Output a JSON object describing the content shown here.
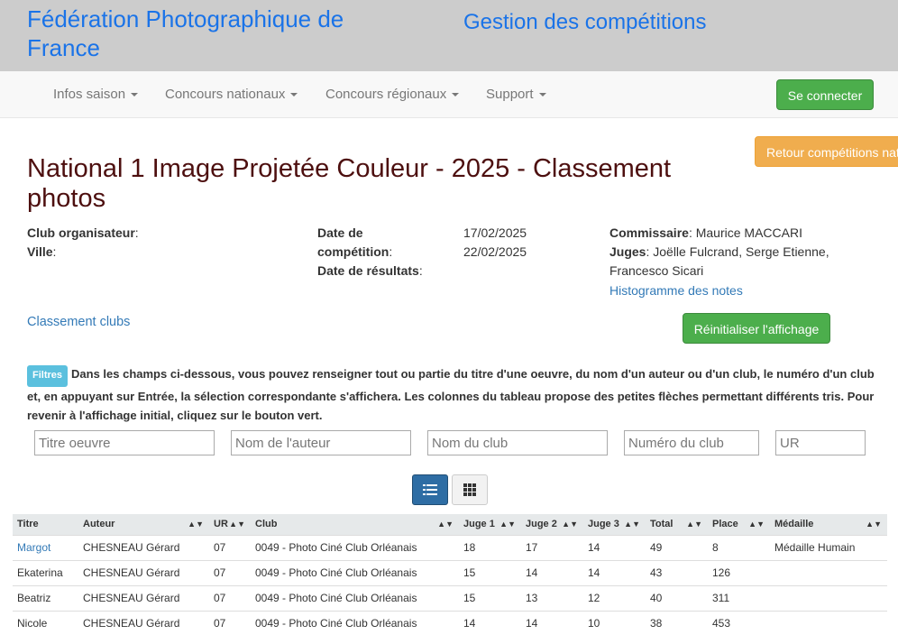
{
  "header": {
    "org_title": "Fédération Photographique de France",
    "app_title": "Gestion des compétitions"
  },
  "nav": {
    "items": [
      "Infos saison",
      "Concours nationaux",
      "Concours régionaux",
      "Support"
    ],
    "login_label": "Se connecter"
  },
  "page": {
    "back_label": "Retour compétitions nat",
    "title": "National 1 Image Projetée Couleur - 2025 - Classement photos"
  },
  "info": {
    "club_label": "Club organisateur",
    "ville_label": "Ville",
    "date_comp_label_1": "Date de",
    "date_comp_label_2": "compétition",
    "date_comp_value": "17/02/2025",
    "date_res_label": "Date de résultats",
    "date_res_value": "22/02/2025",
    "commissaire_label": "Commissaire",
    "commissaire_value": "Maurice MACCARI",
    "juges_label": "Juges",
    "juges_value": "Joëlle Fulcrand, Serge Etienne, Francesco Sicari",
    "histogram_link": "Histogramme des notes",
    "clubs_link": "Classement clubs",
    "reset_label": "Réinitialiser l'affichage"
  },
  "filters": {
    "badge": "Filtres",
    "text": "Dans les champs ci-dessous, vous pouvez renseigner tout ou partie du titre d'une oeuvre, du nom d'un auteur ou d'un club, le numéro d'un club et, en appuyant sur Entrée, la sélection correspondante s'affichera. Les colonnes du tableau propose des petites flèches permettant différents tris. Pour revenir à l'affichage initial, cliquez sur le bouton vert.",
    "placeholders": {
      "titre": "Titre oeuvre",
      "auteur": "Nom de l'auteur",
      "club": "Nom du club",
      "numero": "Numéro du club",
      "ur": "UR"
    }
  },
  "table": {
    "headers": [
      "Titre",
      "Auteur",
      "UR",
      "Club",
      "Juge 1",
      "Juge 2",
      "Juge 3",
      "Total",
      "Place",
      "Médaille"
    ],
    "rows": [
      [
        "Margot",
        "CHESNEAU Gérard",
        "07",
        "0049 - Photo Ciné Club Orléanais",
        "18",
        "17",
        "14",
        "49",
        "8",
        "Médaille Humain"
      ],
      [
        "Ekaterina",
        "CHESNEAU Gérard",
        "07",
        "0049 - Photo Ciné Club Orléanais",
        "15",
        "14",
        "14",
        "43",
        "126",
        ""
      ],
      [
        "Beatriz",
        "CHESNEAU Gérard",
        "07",
        "0049 - Photo Ciné Club Orléanais",
        "15",
        "13",
        "12",
        "40",
        "311",
        ""
      ],
      [
        "Nicole",
        "CHESNEAU Gérard",
        "07",
        "0049 - Photo Ciné Club Orléanais",
        "14",
        "14",
        "10",
        "38",
        "453",
        ""
      ]
    ]
  },
  "colors": {
    "banner_bg": "#cccccc",
    "title_blue": "#1a73e8",
    "page_title": "#4d0f0f",
    "success": "#4cae4c",
    "warning": "#f0ad4e",
    "link": "#337ab7"
  }
}
